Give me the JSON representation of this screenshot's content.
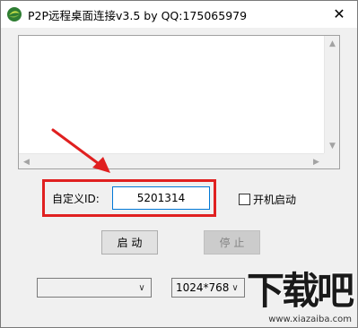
{
  "window": {
    "title": "P2P远程桌面连接v3.5 by QQ:175065979",
    "close_glyph": "✕"
  },
  "form": {
    "id_label": "自定义ID:",
    "id_value": "5201314",
    "autostart_label": "开机启动",
    "autostart_checked": false,
    "start_label": "启 动",
    "stop_label": "停 止",
    "stop_enabled": false
  },
  "selects": {
    "monitor_value": "",
    "resolution_value": "1024*768"
  },
  "watermark": {
    "brand": "下载吧",
    "url": "www.xiazaiba.com"
  },
  "icons": {
    "up": "▲",
    "down": "▼",
    "left": "◀",
    "right": "▶",
    "dropdown": "∨"
  },
  "colors": {
    "highlight": "#e02020",
    "arrow": "#e02020",
    "focus_border": "#0078d7"
  }
}
